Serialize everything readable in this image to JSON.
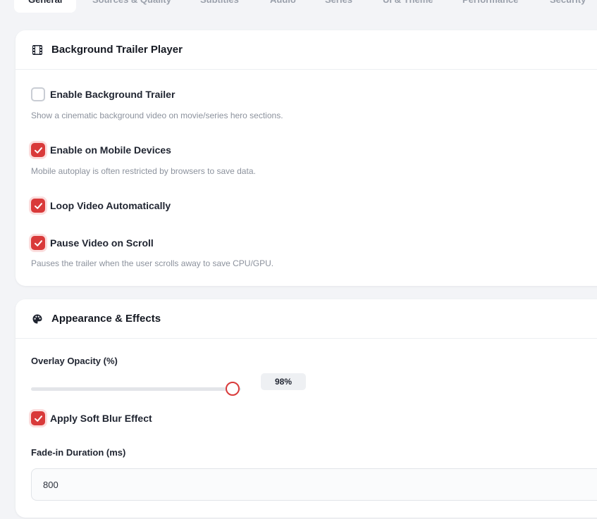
{
  "tabs": [
    {
      "label": "General",
      "active": true
    },
    {
      "label": "Sources & Quality"
    },
    {
      "label": "Subtitles"
    },
    {
      "label": "Audio"
    },
    {
      "label": "Series"
    },
    {
      "label": "UI & Theme"
    },
    {
      "label": "Performance"
    },
    {
      "label": "Security"
    }
  ],
  "trailer": {
    "title": "Background Trailer Player",
    "icon": "film-icon",
    "options": [
      {
        "label": "Enable Background Trailer",
        "checked": false,
        "help": "Show a cinematic background video on movie/series hero sections."
      },
      {
        "label": "Enable on Mobile Devices",
        "checked": true,
        "help": "Mobile autoplay is often restricted by browsers to save data."
      },
      {
        "label": "Loop Video Automatically",
        "checked": true,
        "help": ""
      },
      {
        "label": "Pause Video on Scroll",
        "checked": true,
        "help": "Pauses the trailer when the user scrolls away to save CPU/GPU."
      }
    ]
  },
  "appearance": {
    "title": "Appearance & Effects",
    "icon": "palette-icon",
    "overlay": {
      "label": "Overlay Opacity (%)",
      "value": 98,
      "display": "98%"
    },
    "blur": {
      "label": "Apply Soft Blur Effect",
      "checked": true
    },
    "fade": {
      "label": "Fade-in Duration (ms)",
      "value": "800"
    }
  },
  "colors": {
    "accent": "#d93a3a",
    "accent_soft": "#fbdede"
  }
}
